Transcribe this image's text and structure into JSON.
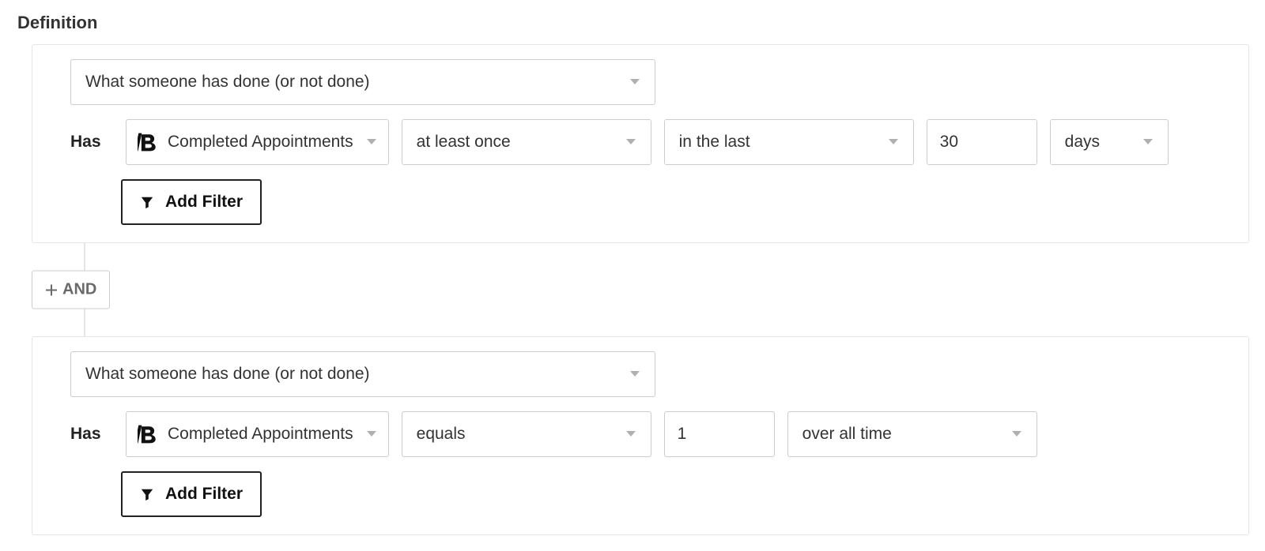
{
  "section_title": "Definition",
  "and_label": "AND",
  "add_filter_label": "Add Filter",
  "rules": [
    {
      "trigger_type": "What someone has done (or not done)",
      "has_label": "Has",
      "metric": "Completed Appointments",
      "frequency": "at least once",
      "range": "in the last",
      "number": "30",
      "unit": "days"
    },
    {
      "trigger_type": "What someone has done (or not done)",
      "has_label": "Has",
      "metric": "Completed Appointments",
      "frequency": "equals",
      "number": "1",
      "range": "over all time"
    }
  ]
}
